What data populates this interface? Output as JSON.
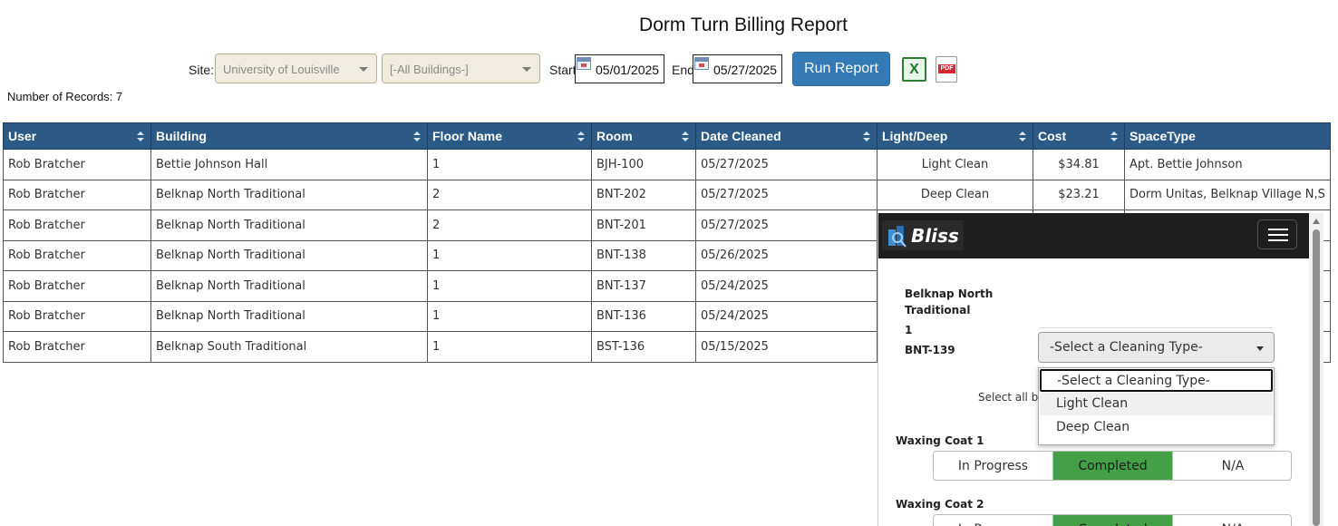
{
  "report": {
    "title": "Dorm Turn Billing Report",
    "records_label": "Number of Records: 7"
  },
  "filters": {
    "site_label": "Site:",
    "site_value": "University of Louisville",
    "building_value": "[-All Buildings-]",
    "start_label": "Start",
    "start_date": "05/01/2025",
    "end_label": "End",
    "end_date": "05/27/2025",
    "run_button": "Run Report",
    "excel_icon": "excel-export-icon",
    "pdf_icon": "pdf-export-icon",
    "pdf_text": "PDF",
    "excel_text": "X"
  },
  "table": {
    "headers": [
      "User",
      "Building",
      "Floor Name",
      "Room",
      "Date Cleaned",
      "Light/Deep",
      "Cost",
      "SpaceType"
    ],
    "rows": [
      [
        "Rob Bratcher",
        "Bettie Johnson Hall",
        "1",
        "BJH-100",
        "05/27/2025",
        "Light Clean",
        "$34.81",
        "Apt. Bettie Johnson"
      ],
      [
        "Rob Bratcher",
        "Belknap North Traditional",
        "2",
        "BNT-202",
        "05/27/2025",
        "Deep Clean",
        "$23.21",
        "Dorm Unitas, Belknap Village N,S"
      ],
      [
        "Rob Bratcher",
        "Belknap North Traditional",
        "2",
        "BNT-201",
        "05/27/2025",
        "",
        "",
        ""
      ],
      [
        "Rob Bratcher",
        "Belknap North Traditional",
        "1",
        "BNT-138",
        "05/26/2025",
        "",
        "",
        ""
      ],
      [
        "Rob Bratcher",
        "Belknap North Traditional",
        "1",
        "BNT-137",
        "05/24/2025",
        "",
        "",
        ""
      ],
      [
        "Rob Bratcher",
        "Belknap North Traditional",
        "1",
        "BNT-136",
        "05/24/2025",
        "",
        "",
        ""
      ],
      [
        "Rob Bratcher",
        "Belknap South Traditional",
        "1",
        "BST-136",
        "05/15/2025",
        "",
        "",
        ""
      ]
    ]
  },
  "mobile_panel": {
    "logo_text": "Bliss",
    "building_line1": "Belknap North",
    "building_line2": "Traditional",
    "floor": "1",
    "room": "BNT-139",
    "select_value": "-Select a Cleaning Type-",
    "options": [
      "-Select a Cleaning Type-",
      "Light Clean",
      "Deep Clean"
    ],
    "select_all_text": "Select all be",
    "waxing1": {
      "label": "Waxing Coat 1",
      "options": [
        "In Progress",
        "Completed",
        "N/A"
      ],
      "selected": "Completed"
    },
    "waxing2": {
      "label": "Waxing Coat 2",
      "options": [
        "In Progress",
        "Completed",
        "N/A"
      ],
      "selected": "Completed"
    }
  },
  "colors": {
    "header_bg": "#2b5a86",
    "run_button": "#337ab7",
    "completed": "#43a047",
    "panel_bar": "#1e1e1e"
  }
}
